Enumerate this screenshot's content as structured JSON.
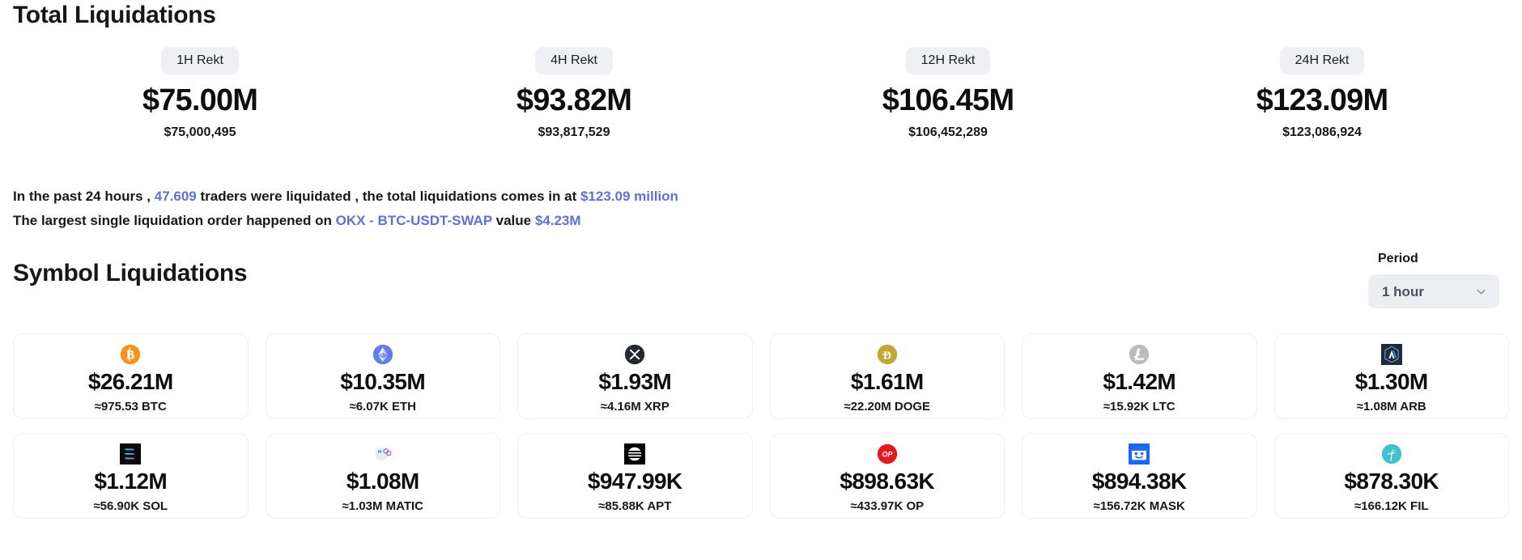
{
  "total": {
    "title": "Total Liquidations",
    "stats": [
      {
        "badge": "1H Rekt",
        "value": "$75.00M",
        "exact": "$75,000,495"
      },
      {
        "badge": "4H Rekt",
        "value": "$93.82M",
        "exact": "$93,817,529"
      },
      {
        "badge": "12H Rekt",
        "value": "$106.45M",
        "exact": "$106,452,289"
      },
      {
        "badge": "24H Rekt",
        "value": "$123.09M",
        "exact": "$123,086,924"
      }
    ]
  },
  "summary": {
    "line1_a": "In the past 24 hours , ",
    "line1_traders": "47.609",
    "line1_b": " traders were liquidated , the total liquidations comes in at ",
    "line1_total": "$123.09 million",
    "line2_a": "The largest single liquidation order happened on ",
    "line2_market": "OKX - BTC-USDT-SWAP",
    "line2_b": " value ",
    "line2_value": "$4.23M"
  },
  "symbols": {
    "title": "Symbol Liquidations",
    "period_label": "Period",
    "period_value": "1 hour",
    "period_icon": "chevron-down-icon",
    "cards": [
      {
        "icon": "btc-icon",
        "value": "$26.21M",
        "amount": "≈975.53 BTC"
      },
      {
        "icon": "eth-icon",
        "value": "$10.35M",
        "amount": "≈6.07K ETH"
      },
      {
        "icon": "xrp-icon",
        "value": "$1.93M",
        "amount": "≈4.16M XRP"
      },
      {
        "icon": "doge-icon",
        "value": "$1.61M",
        "amount": "≈22.20M DOGE"
      },
      {
        "icon": "ltc-icon",
        "value": "$1.42M",
        "amount": "≈15.92K LTC"
      },
      {
        "icon": "arb-icon",
        "value": "$1.30M",
        "amount": "≈1.08M ARB"
      },
      {
        "icon": "sol-icon",
        "value": "$1.12M",
        "amount": "≈56.90K SOL"
      },
      {
        "icon": "matic-icon",
        "value": "$1.08M",
        "amount": "≈1.03M MATIC"
      },
      {
        "icon": "apt-icon",
        "value": "$947.99K",
        "amount": "≈85.88K APT"
      },
      {
        "icon": "op-icon",
        "value": "$898.63K",
        "amount": "≈433.97K OP"
      },
      {
        "icon": "mask-icon",
        "value": "$894.38K",
        "amount": "≈156.72K MASK"
      },
      {
        "icon": "fil-icon",
        "value": "$878.30K",
        "amount": "≈166.12K FIL"
      }
    ]
  },
  "colors": {
    "link": "#6070d6",
    "badge_bg": "#eef0f3",
    "card_border": "#eceef1",
    "btc": "#f7931a",
    "eth": "#627eea",
    "xrp": "#23292f",
    "doge": "#c3a634",
    "ltc": "#bfbbbb",
    "arb": "#1b2a3f",
    "sol": "#000000",
    "matic": "#8247e5",
    "apt": "#000000",
    "op": "#e3191e",
    "mask": "#1c68f3",
    "fil": "#42c1ca"
  }
}
